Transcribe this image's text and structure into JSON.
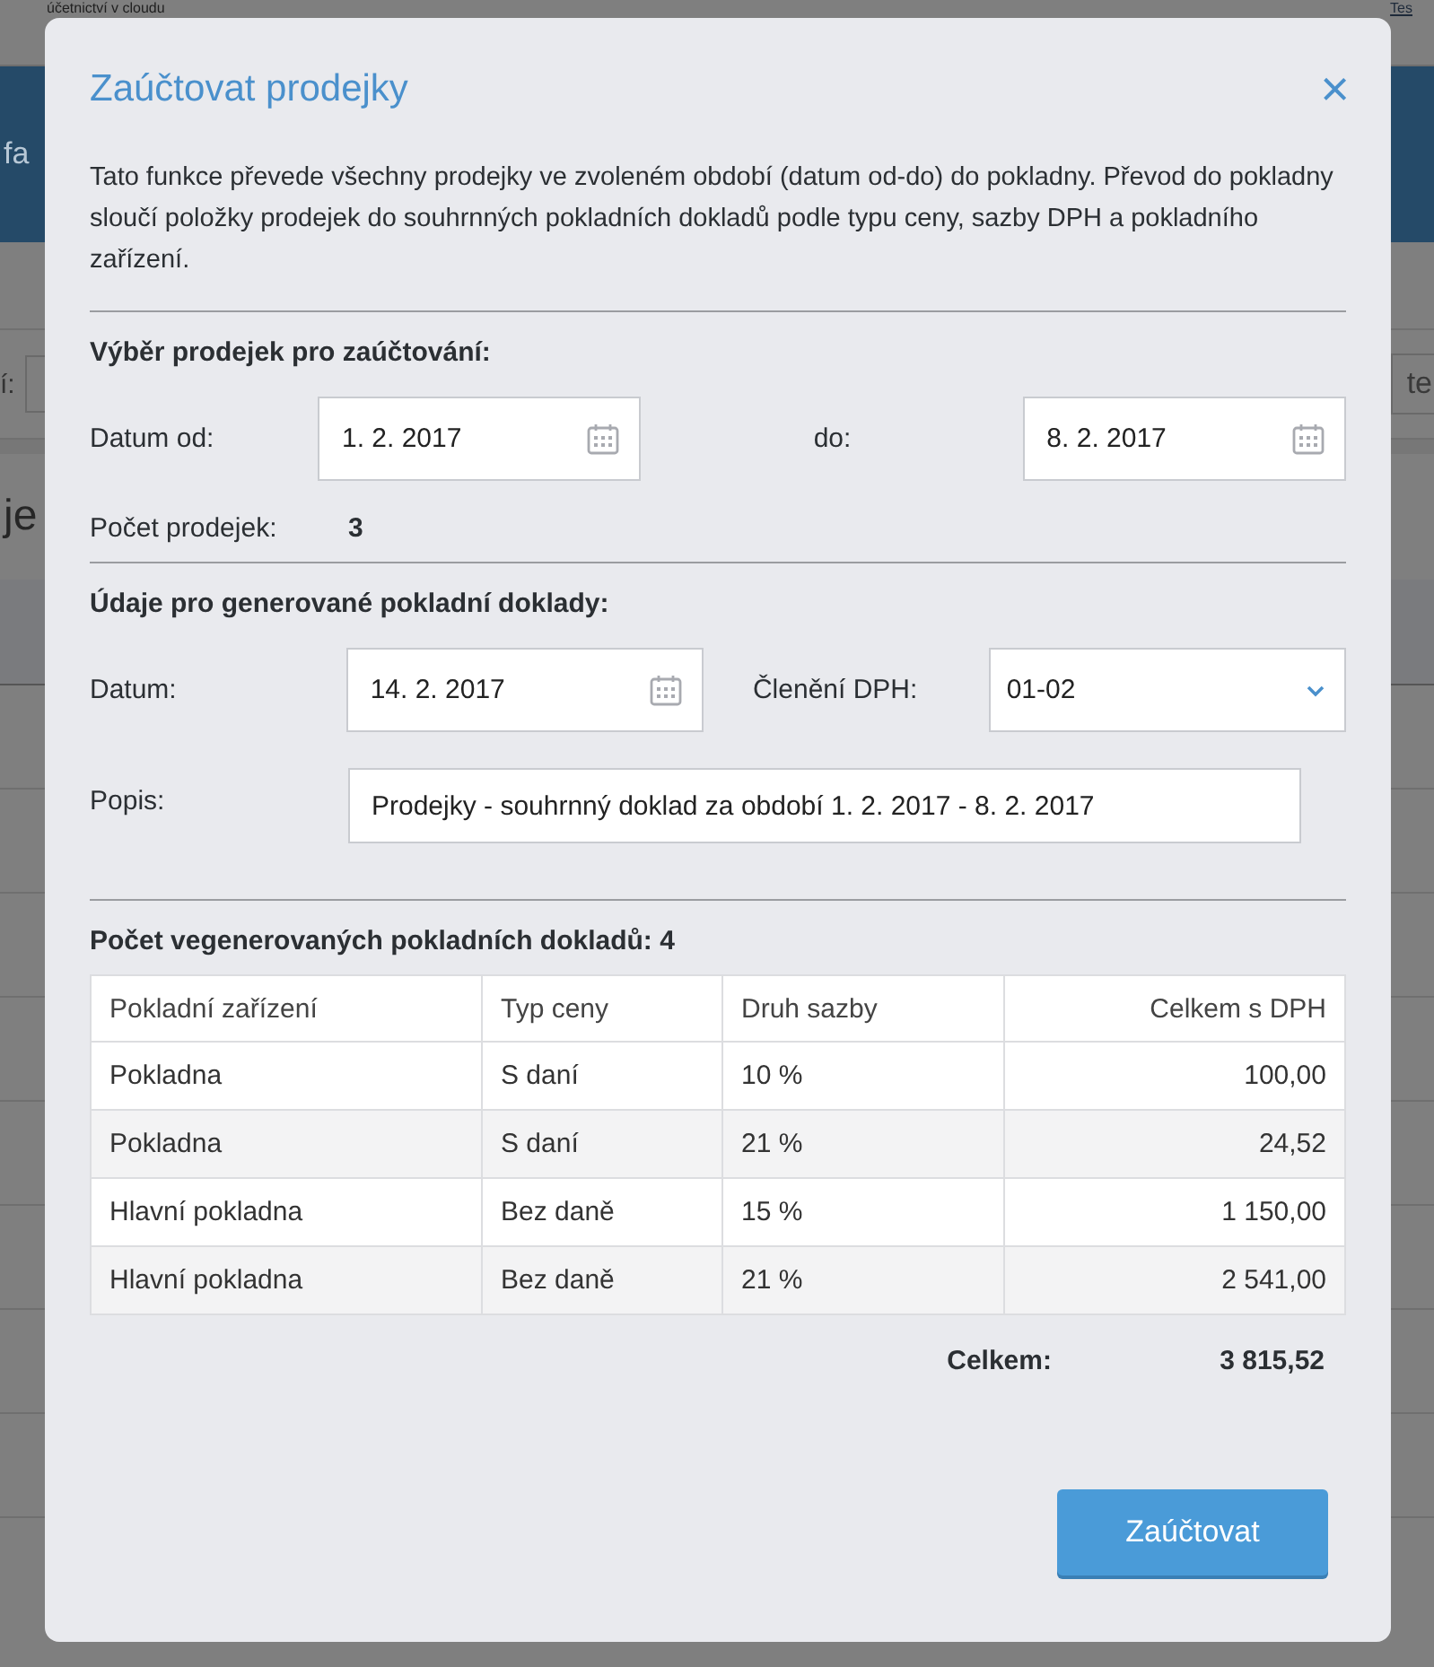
{
  "background": {
    "header_text": "účetnictví v cloudu",
    "header_link": "Tes",
    "banner_text": "fa",
    "filter_label": "í:",
    "filter_placeholder": "te",
    "heading": "je"
  },
  "dialog": {
    "title": "Zaúčtovat prodejky",
    "close": "×",
    "description": "Tato funkce převede všechny prodejky ve zvoleném období (datum od-do) do pokladny. Převod do pokladny sloučí položky prodejek do souhrnných pokladních dokladů podle typu ceny, sazby DPH a pokladního zařízení.",
    "selection": {
      "heading": "Výběr prodejek pro zaúčtování:",
      "date_from_label": "Datum od:",
      "date_from": "1. 2. 2017",
      "date_to_label": "do:",
      "date_to": "8. 2. 2017",
      "count_label": "Počet prodejek:",
      "count": "3"
    },
    "generated": {
      "heading": "Údaje pro generované pokladní doklady:",
      "date_label": "Datum:",
      "date": "14. 2. 2017",
      "vat_label": "Členění DPH:",
      "vat": "01-02",
      "description_label": "Popis:",
      "description": "Prodejky - souhrnný doklad za období 1. 2. 2017 - 8. 2. 2017"
    },
    "table": {
      "heading": "Počet vegenerovaných pokladních dokladů: 4",
      "columns": [
        "Pokladní zařízení",
        "Typ ceny",
        "Druh sazby",
        "Celkem s DPH"
      ],
      "rows": [
        [
          "Pokladna",
          "S daní",
          "10 %",
          "100,00"
        ],
        [
          "Pokladna",
          "S daní",
          "21 %",
          "24,52"
        ],
        [
          "Hlavní pokladna",
          "Bez daně",
          "15 %",
          "1 150,00"
        ],
        [
          "Hlavní pokladna",
          "Bez daně",
          "21 %",
          "2 541,00"
        ]
      ],
      "total_label": "Celkem:",
      "total": "3 815,52"
    },
    "submit": "Zaúčtovat"
  }
}
